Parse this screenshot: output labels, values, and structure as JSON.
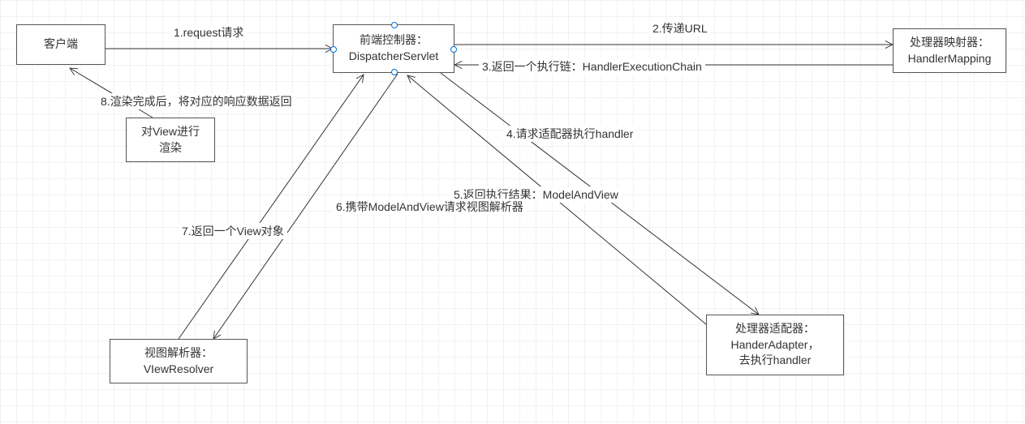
{
  "nodes": {
    "client": "客户端",
    "dispatcher_l1": "前端控制器：",
    "dispatcher_l2": "DispatcherServlet",
    "mapping_l1": "处理器映射器：",
    "mapping_l2": "HandlerMapping",
    "render_l1": "对View进行",
    "render_l2": "渲染",
    "resolver_l1": "视图解析器：",
    "resolver_l2": "VIewResolver",
    "adapter_l1": "处理器适配器：",
    "adapter_l2": "HanderAdapter，",
    "adapter_l3": "去执行handler"
  },
  "edges": {
    "e1": "1.request请求",
    "e2": "2.传递URL",
    "e3": "3.返回一个执行链：HandlerExecutionChain",
    "e4": "4.请求适配器执行handler",
    "e5": "5.返回执行结果：ModelAndView",
    "e6": "6.携带ModelAndView请求视图解析器",
    "e7": "7.返回一个View对象",
    "e8": "8.渲染完成后，将对应的响应数据返回"
  }
}
